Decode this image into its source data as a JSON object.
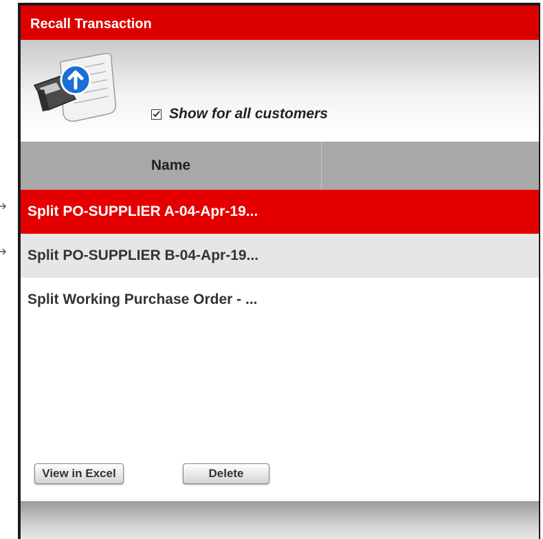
{
  "window": {
    "title": "Recall Transaction"
  },
  "header": {
    "show_all_label": "Show for all customers",
    "show_all_checked": true,
    "icon": "recall-scroll-icon"
  },
  "table": {
    "columns": [
      "Name",
      ""
    ],
    "rows": [
      {
        "name": "Split PO-SUPPLIER A-04-Apr-19...",
        "state": "selected"
      },
      {
        "name": "Split PO-SUPPLIER B-04-Apr-19...",
        "state": "alternate"
      },
      {
        "name": "Split Working Purchase Order - ...",
        "state": "normal"
      }
    ]
  },
  "buttons": {
    "view_excel": "View in Excel",
    "delete": "Delete"
  },
  "colors": {
    "title_bar": "#dd0000",
    "selected_row": "#e40000",
    "header_bg": "#a8a8a8"
  }
}
